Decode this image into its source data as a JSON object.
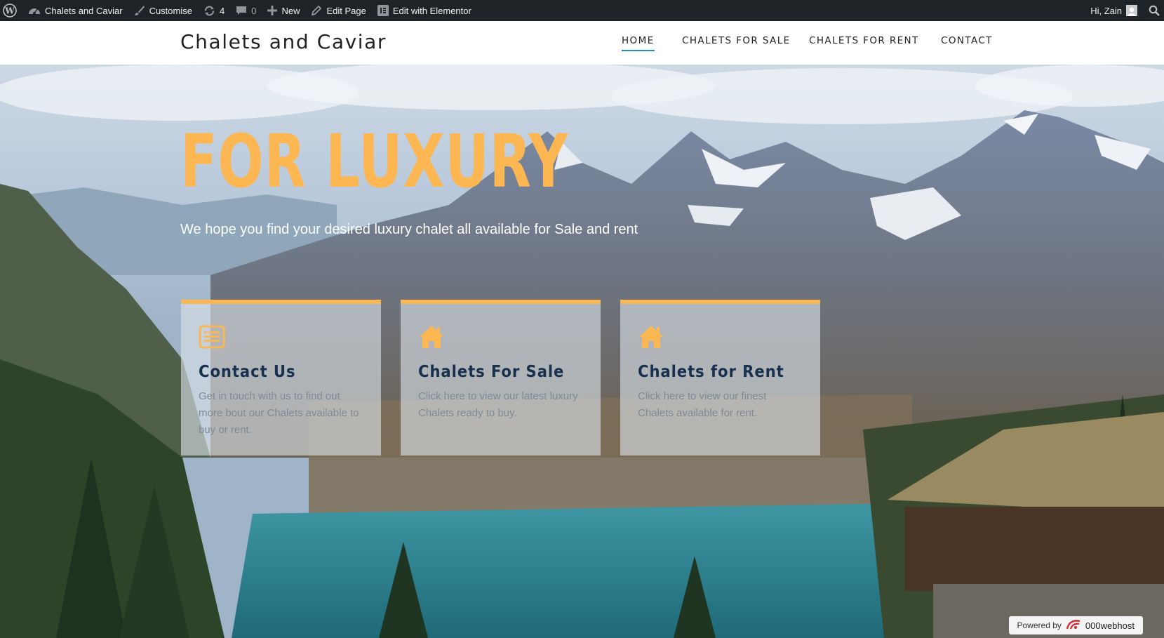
{
  "adminbar": {
    "site_name": "Chalets and Caviar",
    "customise": "Customise",
    "updates_count": "4",
    "comments_count": "0",
    "new_label": "New",
    "edit_page": "Edit Page",
    "edit_elementor": "Edit with Elementor",
    "greeting": "Hi, Zain"
  },
  "header": {
    "site_title": "Chalets and Caviar",
    "nav": [
      {
        "label": "HOME",
        "active": true
      },
      {
        "label": "CHALETS FOR SALE",
        "active": false
      },
      {
        "label": "CHALETS FOR RENT",
        "active": false
      },
      {
        "label": "CONTACT",
        "active": false
      }
    ]
  },
  "hero": {
    "title": "FOR LUXURY",
    "subtitle": "We hope you find your desired luxury chalet all available for Sale and rent",
    "accent_color": "#fcb753",
    "cards": [
      {
        "icon": "document-list-icon",
        "title": "Contact Us",
        "text": "Get in touch with us to find out more bout our Chalets available to buy or rent."
      },
      {
        "icon": "house-icon",
        "title": "Chalets For Sale",
        "text": "Click here to view our latest luxury Chalets ready to buy."
      },
      {
        "icon": "house-icon",
        "title": "Chalets for Rent",
        "text": "Click here to view our finest Chalets available for rent."
      }
    ]
  },
  "footer_badge": {
    "powered_label": "Powered by",
    "brand": "000webhost"
  }
}
